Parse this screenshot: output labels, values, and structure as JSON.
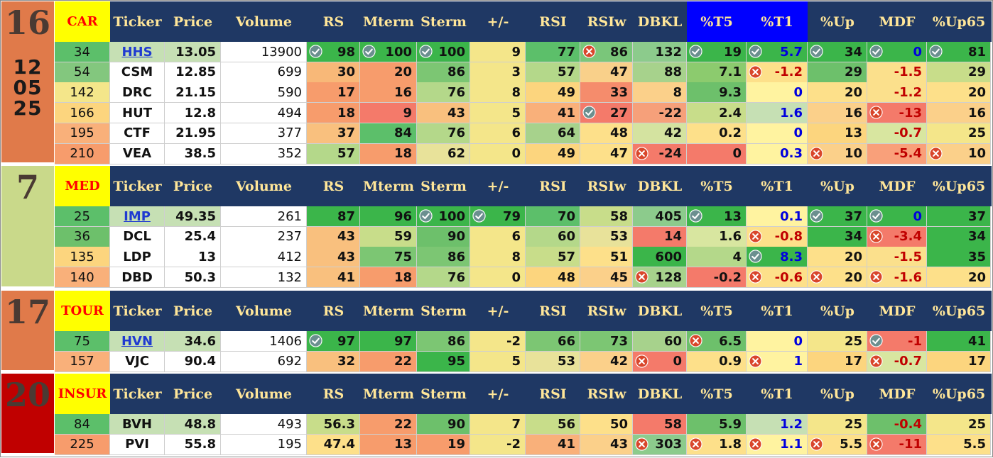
{
  "columns": [
    "Ticker",
    "Price",
    "Volume",
    "RS",
    "Mterm",
    "Sterm",
    "+/-",
    "RSI",
    "RSIw",
    "DBKL",
    "%T5",
    "%T1",
    "%Up",
    "MDF",
    "%Up65"
  ],
  "colors": {
    "header_bg": "#1f3864",
    "header_text": "#ffe699",
    "tag_bg": "#ffff00",
    "tag_text": "#ff0000",
    "highlight_header": "#0000ff",
    "check_icon": "#6b8f8f",
    "cross_icon": "#d9462b"
  },
  "groups": [
    {
      "rank": "16",
      "tag": "CAR",
      "date": [
        "12",
        "05",
        "25"
      ],
      "block_color": "#e07a4a",
      "rows": [
        {
          "rank": "34",
          "ticker": "HHS",
          "ticker_link": true,
          "price": "13.05",
          "volume": "13900",
          "rs": "98",
          "mterm": "100",
          "sterm": "100",
          "pm": "9",
          "rsi": "77",
          "rsiw": "86",
          "dbkl": "132",
          "t5": "19",
          "t1": "5.7",
          "up": "34",
          "mdf": "0",
          "up65": "81",
          "icons": {
            "rs": "check",
            "mterm": "check",
            "sterm": "check",
            "rsiw": "cross",
            "t5": "check",
            "t1": "check",
            "up": "check",
            "mdf": "check",
            "up65": "check"
          },
          "bg": {
            "rank": "#5cbf6a",
            "ticker": "#c6e0b4",
            "price": "#c6e0b4",
            "volume": "#ffffff",
            "rs": "#3bb54a",
            "mterm": "#3bb54a",
            "sterm": "#3bb54a",
            "pm": "#f4e68a",
            "rsi": "#5cbf6a",
            "rsiw": "#7ac67a",
            "dbkl": "#8ccb8c",
            "t5": "#3bb54a",
            "t1": "#3bb54a",
            "up": "#3bb54a",
            "mdf": "#3bb54a",
            "up65": "#3bb54a"
          },
          "tc": {
            "t1": "blue",
            "mdf": "blue"
          }
        },
        {
          "rank": "54",
          "ticker": "CSM",
          "price": "12.85",
          "volume": "699",
          "rs": "30",
          "mterm": "20",
          "sterm": "86",
          "pm": "3",
          "rsi": "57",
          "rsiw": "47",
          "dbkl": "88",
          "t5": "7.1",
          "t1": "-1.2",
          "up": "29",
          "mdf": "-1.5",
          "up65": "29",
          "icons": {
            "t1": "cross"
          },
          "bg": {
            "rank": "#83c77e",
            "ticker": "#ffffff",
            "price": "#ffffff",
            "volume": "#ffffff",
            "rs": "#f8b878",
            "mterm": "#f79c6c",
            "sterm": "#7cc673",
            "pm": "#f4e68a",
            "rsi": "#b4d88a",
            "rsiw": "#f9d08a",
            "dbkl": "#a7d28c",
            "t5": "#8ccb6e",
            "t1": "#fde08a",
            "up": "#6dc06b",
            "mdf": "#fbe08c",
            "up65": "#c8dd8a"
          },
          "tc": {
            "t1": "red",
            "mdf": "red"
          }
        },
        {
          "rank": "142",
          "ticker": "DRC",
          "price": "21.15",
          "volume": "590",
          "rs": "17",
          "mterm": "16",
          "sterm": "76",
          "pm": "8",
          "rsi": "49",
          "rsiw": "33",
          "dbkl": "8",
          "t5": "9.3",
          "t1": "0",
          "up": "20",
          "mdf": "-1.2",
          "up65": "20",
          "icons": {},
          "bg": {
            "rank": "#f4e68a",
            "ticker": "#ffffff",
            "price": "#ffffff",
            "volume": "#ffffff",
            "rs": "#f79c6c",
            "mterm": "#f79c6c",
            "sterm": "#b4d88a",
            "pm": "#f4e68a",
            "rsi": "#fcd57e",
            "rsiw": "#f58c6c",
            "dbkl": "#fbd08a",
            "t5": "#6dc06b",
            "t1": "#fff3a0",
            "up": "#fde08a",
            "mdf": "#fbe08c",
            "up65": "#fde08a"
          },
          "tc": {
            "t1": "blue",
            "mdf": "red"
          }
        },
        {
          "rank": "166",
          "ticker": "HUT",
          "price": "12.8",
          "volume": "494",
          "rs": "18",
          "mterm": "9",
          "sterm": "43",
          "pm": "5",
          "rsi": "41",
          "rsiw": "27",
          "dbkl": "-22",
          "t5": "2.4",
          "t1": "1.6",
          "up": "16",
          "mdf": "-13",
          "up65": "16",
          "icons": {
            "rsiw": "check",
            "mdf": "cross"
          },
          "bg": {
            "rank": "#fcd57e",
            "ticker": "#ffffff",
            "price": "#ffffff",
            "volume": "#ffffff",
            "rs": "#f79c6c",
            "mterm": "#f47a6a",
            "sterm": "#f9c07e",
            "pm": "#f4e68a",
            "rsi": "#f9b07a",
            "rsiw": "#f47a6a",
            "dbkl": "#f6a07a",
            "t5": "#c8dd8a",
            "t1": "#c6e0b4",
            "up": "#fbd08a",
            "mdf": "#f47a6a",
            "up65": "#fbd08a"
          },
          "tc": {
            "t1": "blue",
            "mdf": "red"
          }
        },
        {
          "rank": "195",
          "ticker": "CTF",
          "price": "21.95",
          "volume": "377",
          "rs": "37",
          "mterm": "84",
          "sterm": "76",
          "pm": "6",
          "rsi": "64",
          "rsiw": "48",
          "dbkl": "42",
          "t5": "0.2",
          "t1": "0",
          "up": "13",
          "mdf": "-0.7",
          "up65": "25",
          "icons": {},
          "bg": {
            "rank": "#f9b07a",
            "ticker": "#ffffff",
            "price": "#ffffff",
            "volume": "#ffffff",
            "rs": "#f9c07e",
            "mterm": "#5cbf6a",
            "sterm": "#b4d88a",
            "pm": "#f4e68a",
            "rsi": "#a7d28c",
            "rsiw": "#fde08a",
            "dbkl": "#d4e3a0",
            "t5": "#fde08a",
            "t1": "#fff3a0",
            "up": "#fcd57e",
            "mdf": "#d8e6a0",
            "up65": "#f4e68a"
          },
          "tc": {
            "t1": "blue",
            "mdf": "red"
          }
        },
        {
          "rank": "210",
          "ticker": "VEA",
          "price": "38.5",
          "volume": "352",
          "rs": "57",
          "mterm": "18",
          "sterm": "62",
          "pm": "0",
          "rsi": "49",
          "rsiw": "47",
          "dbkl": "-24",
          "t5": "0",
          "t1": "0.3",
          "up": "10",
          "mdf": "-5.4",
          "up65": "10",
          "icons": {
            "dbkl": "cross",
            "up": "cross",
            "up65": "cross"
          },
          "bg": {
            "rank": "#f79c6c",
            "ticker": "#ffffff",
            "price": "#ffffff",
            "volume": "#ffffff",
            "rs": "#b4d88a",
            "mterm": "#f79c6c",
            "sterm": "#e8e29a",
            "pm": "#f4e68a",
            "rsi": "#fcd57e",
            "rsiw": "#fde08a",
            "dbkl": "#f47a6a",
            "t5": "#f47a6a",
            "t1": "#fff3a0",
            "up": "#fbd08a",
            "mdf": "#f9a07a",
            "up65": "#fbd08a"
          },
          "tc": {
            "t1": "blue",
            "mdf": "red"
          }
        }
      ]
    },
    {
      "rank": "7",
      "tag": "MED",
      "date": [],
      "block_color": "#c9d98a",
      "rows": [
        {
          "rank": "25",
          "ticker": "IMP",
          "ticker_link": true,
          "price": "49.35",
          "volume": "261",
          "rs": "87",
          "mterm": "96",
          "sterm": "100",
          "pm": "79",
          "rsi": "70",
          "rsiw": "58",
          "dbkl": "405",
          "t5": "13",
          "t1": "0.1",
          "up": "37",
          "mdf": "0",
          "up65": "37",
          "icons": {
            "sterm": "check",
            "pm": "check",
            "t5": "check",
            "up": "check",
            "mdf": "check"
          },
          "bg": {
            "rank": "#5cbf6a",
            "ticker": "#c6e0b4",
            "price": "#c6e0b4",
            "volume": "#ffffff",
            "rs": "#3bb54a",
            "mterm": "#3bb54a",
            "sterm": "#3bb54a",
            "pm": "#3bb54a",
            "rsi": "#5cbf6a",
            "rsiw": "#c8dd8a",
            "dbkl": "#8ccb8c",
            "t5": "#3bb54a",
            "t1": "#fff3a0",
            "up": "#3bb54a",
            "mdf": "#3bb54a",
            "up65": "#3bb54a"
          },
          "tc": {
            "t1": "blue",
            "mdf": "blue"
          }
        },
        {
          "rank": "36",
          "ticker": "DCL",
          "price": "25.4",
          "volume": "237",
          "rs": "43",
          "mterm": "59",
          "sterm": "90",
          "pm": "6",
          "rsi": "60",
          "rsiw": "53",
          "dbkl": "14",
          "t5": "1.6",
          "t1": "-0.8",
          "up": "34",
          "mdf": "-3.4",
          "up65": "34",
          "icons": {
            "t1": "cross",
            "mdf": "cross"
          },
          "bg": {
            "rank": "#6dc06b",
            "ticker": "#ffffff",
            "price": "#ffffff",
            "volume": "#ffffff",
            "rs": "#f9c07e",
            "mterm": "#c8dd8a",
            "sterm": "#6dc06b",
            "pm": "#f4e68a",
            "rsi": "#b4d88a",
            "rsiw": "#e8e29a",
            "dbkl": "#f47a6a",
            "t5": "#d8e6a0",
            "t1": "#fde08a",
            "up": "#3bb54a",
            "mdf": "#f47a6a",
            "up65": "#3bb54a"
          },
          "tc": {
            "t1": "red",
            "mdf": "red"
          }
        },
        {
          "rank": "135",
          "ticker": "LDP",
          "price": "13",
          "volume": "412",
          "rs": "43",
          "mterm": "75",
          "sterm": "86",
          "pm": "8",
          "rsi": "57",
          "rsiw": "51",
          "dbkl": "600",
          "t5": "4",
          "t1": "8.3",
          "up": "20",
          "mdf": "-1.5",
          "up65": "35",
          "icons": {
            "t1": "check"
          },
          "bg": {
            "rank": "#fcd57e",
            "ticker": "#ffffff",
            "price": "#ffffff",
            "volume": "#ffffff",
            "rs": "#f9c07e",
            "mterm": "#7cc673",
            "sterm": "#7cc673",
            "pm": "#f4e68a",
            "rsi": "#c8dd8a",
            "rsiw": "#fde08a",
            "dbkl": "#3bb54a",
            "t5": "#b4d88a",
            "t1": "#3bb54a",
            "up": "#fde08a",
            "mdf": "#fbe08c",
            "up65": "#3bb54a"
          },
          "tc": {
            "t1": "blue",
            "mdf": "red"
          }
        },
        {
          "rank": "140",
          "ticker": "DBD",
          "price": "50.3",
          "volume": "132",
          "rs": "41",
          "mterm": "18",
          "sterm": "76",
          "pm": "0",
          "rsi": "48",
          "rsiw": "45",
          "dbkl": "128",
          "t5": "-0.2",
          "t1": "-0.6",
          "up": "20",
          "mdf": "-1.6",
          "up65": "20",
          "icons": {
            "dbkl": "cross",
            "t1": "cross",
            "up": "cross",
            "mdf": "cross"
          },
          "bg": {
            "rank": "#f9b07a",
            "ticker": "#ffffff",
            "price": "#ffffff",
            "volume": "#ffffff",
            "rs": "#f9c07e",
            "mterm": "#f79c6c",
            "sterm": "#b4d88a",
            "pm": "#f4e68a",
            "rsi": "#fcd57e",
            "rsiw": "#fbd08a",
            "dbkl": "#a7d28c",
            "t5": "#f47a6a",
            "t1": "#fde08a",
            "up": "#fde08a",
            "mdf": "#fbe08c",
            "up65": "#fde08a"
          },
          "tc": {
            "t1": "red",
            "mdf": "red"
          }
        }
      ]
    },
    {
      "rank": "17",
      "tag": "TOUR",
      "date": [],
      "block_color": "#e07a4a",
      "rows": [
        {
          "rank": "75",
          "ticker": "HVN",
          "ticker_link": true,
          "price": "34.6",
          "volume": "1406",
          "rs": "97",
          "mterm": "97",
          "sterm": "86",
          "pm": "-2",
          "rsi": "66",
          "rsiw": "73",
          "dbkl": "60",
          "t5": "6.5",
          "t1": "0",
          "up": "25",
          "mdf": "-1",
          "up65": "41",
          "icons": {
            "rs": "check",
            "t5": "cross",
            "mdf": "check"
          },
          "bg": {
            "rank": "#5cbf6a",
            "ticker": "#c6e0b4",
            "price": "#c6e0b4",
            "volume": "#ffffff",
            "rs": "#3bb54a",
            "mterm": "#3bb54a",
            "sterm": "#7cc673",
            "pm": "#f4e68a",
            "rsi": "#7cc673",
            "rsiw": "#7cc673",
            "dbkl": "#a7d28c",
            "t5": "#6dc06b",
            "t1": "#fff3a0",
            "up": "#f4e68a",
            "mdf": "#f47a6a",
            "up65": "#3bb54a"
          },
          "tc": {
            "t1": "blue",
            "mdf": "red"
          }
        },
        {
          "rank": "157",
          "ticker": "VJC",
          "price": "90.4",
          "volume": "692",
          "rs": "32",
          "mterm": "22",
          "sterm": "95",
          "pm": "5",
          "rsi": "53",
          "rsiw": "42",
          "dbkl": "0",
          "t5": "0.9",
          "t1": "1",
          "up": "17",
          "mdf": "-0.7",
          "up65": "17",
          "icons": {
            "dbkl": "cross",
            "t1": "cross",
            "mdf": "cross"
          },
          "bg": {
            "rank": "#f9b07a",
            "ticker": "#ffffff",
            "price": "#ffffff",
            "volume": "#ffffff",
            "rs": "#f9c07e",
            "mterm": "#f79c6c",
            "sterm": "#3bb54a",
            "pm": "#f4e68a",
            "rsi": "#e8e29a",
            "rsiw": "#fbd08a",
            "dbkl": "#f47a6a",
            "t5": "#fde08a",
            "t1": "#fff3a0",
            "up": "#fcd57e",
            "mdf": "#d8e6a0",
            "up65": "#fcd57e"
          },
          "tc": {
            "t1": "blue",
            "mdf": "red"
          }
        }
      ]
    },
    {
      "rank": "20",
      "tag": "INSUR",
      "date": [],
      "block_color": "#c00000",
      "rows": [
        {
          "rank": "84",
          "ticker": "BVH",
          "price": "48.8",
          "volume": "493",
          "rs": "56.3",
          "mterm": "22",
          "sterm": "90",
          "pm": "7",
          "rsi": "56",
          "rsiw": "50",
          "dbkl": "58",
          "t5": "5.9",
          "t1": "1.2",
          "up": "25",
          "mdf": "-0.4",
          "up65": "25",
          "icons": {},
          "bg": {
            "rank": "#5cbf6a",
            "ticker": "#c6e0b4",
            "price": "#c6e0b4",
            "volume": "#ffffff",
            "rs": "#c8dd8a",
            "mterm": "#f79c6c",
            "sterm": "#6dc06b",
            "pm": "#f4e68a",
            "rsi": "#c8dd8a",
            "rsiw": "#fde08a",
            "dbkl": "#f47a6a",
            "t5": "#6dc06b",
            "t1": "#c6e0b4",
            "up": "#f4e68a",
            "mdf": "#6dc06b",
            "up65": "#f4e68a"
          },
          "tc": {
            "t1": "blue",
            "mdf": "red"
          }
        },
        {
          "rank": "225",
          "ticker": "PVI",
          "price": "55.8",
          "volume": "195",
          "rs": "47.4",
          "mterm": "13",
          "sterm": "19",
          "pm": "-2",
          "rsi": "41",
          "rsiw": "43",
          "dbkl": "303",
          "t5": "1.8",
          "t1": "1.1",
          "up": "5.5",
          "mdf": "-11",
          "up65": "5.5",
          "icons": {
            "dbkl": "cross",
            "t5": "cross",
            "t1": "cross",
            "up": "cross",
            "mdf": "cross"
          },
          "bg": {
            "rank": "#f79c6c",
            "ticker": "#ffffff",
            "price": "#ffffff",
            "volume": "#ffffff",
            "rs": "#fde08a",
            "mterm": "#f79c6c",
            "sterm": "#f79c6c",
            "pm": "#f4e68a",
            "rsi": "#f9b07a",
            "rsiw": "#fbd08a",
            "dbkl": "#8ccb8c",
            "t5": "#fde08a",
            "t1": "#fff3a0",
            "up": "#fde08a",
            "mdf": "#f47a6a",
            "up65": "#fde08a"
          },
          "tc": {
            "t1": "blue",
            "mdf": "red"
          }
        }
      ]
    }
  ]
}
